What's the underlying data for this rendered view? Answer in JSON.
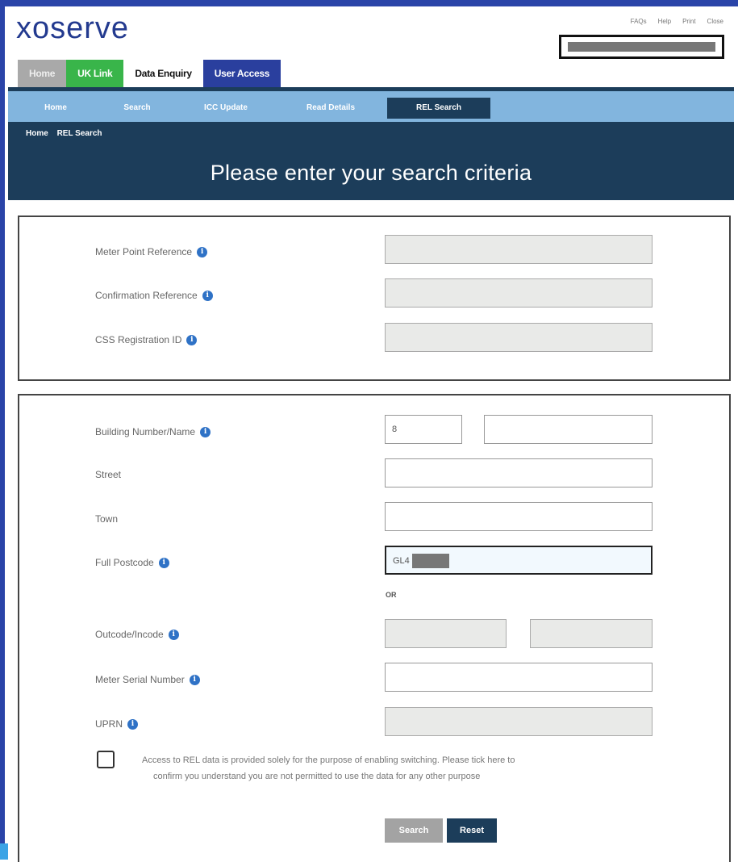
{
  "app": {
    "logo_text": "xoserve",
    "colors": {
      "brand": "#233a8f",
      "nav_dark": "#1c3d5a",
      "nav_light": "#82b5de",
      "uk_link": "#39b54a"
    }
  },
  "top_links": [
    "FAQs",
    "Help",
    "Print",
    "Close"
  ],
  "main_tabs": [
    "Home",
    "UK Link",
    "Data Enquiry",
    "User Access"
  ],
  "sub_nav": [
    "Home",
    "Search",
    "ICC Update",
    "Read Details",
    "REL Search"
  ],
  "breadcrumb": [
    "Home",
    "REL Search"
  ],
  "page_title": "Please enter your search criteria",
  "panel1": {
    "meter_point_reference": {
      "label": "Meter Point Reference",
      "value": ""
    },
    "confirmation_reference": {
      "label": "Confirmation Reference",
      "value": ""
    },
    "css_registration_id": {
      "label": "CSS Registration ID",
      "value": ""
    }
  },
  "panel2": {
    "building": {
      "label": "Building Number/Name",
      "number_value": "8",
      "name_value": ""
    },
    "street": {
      "label": "Street",
      "value": ""
    },
    "town": {
      "label": "Town",
      "value": ""
    },
    "full_postcode": {
      "label": "Full Postcode",
      "value": "GL4"
    },
    "or_text": "OR",
    "outcode_incode": {
      "label": "Outcode/Incode",
      "outcode": "",
      "incode": ""
    },
    "meter_serial_number": {
      "label": "Meter Serial Number",
      "value": ""
    },
    "uprn": {
      "label": "UPRN",
      "value": ""
    },
    "consent_line1": "Access to REL data is provided solely for the purpose of enabling switching. Please tick here to",
    "consent_line2": "confirm you understand you are not permitted to use the data for any other purpose",
    "search_label": "Search",
    "reset_label": "Reset"
  },
  "icons": {
    "info": "info-icon",
    "checkbox": "checkbox-unchecked"
  }
}
